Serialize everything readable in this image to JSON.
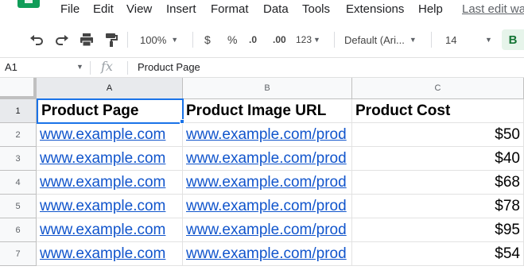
{
  "menu": {
    "items": [
      "File",
      "Edit",
      "View",
      "Insert",
      "Format",
      "Data",
      "Tools",
      "Extensions",
      "Help"
    ],
    "last_edit": "Last edit wa"
  },
  "toolbar": {
    "zoom": "100%",
    "currency": "$",
    "percent": "%",
    "decrease_decimal": ".0",
    "increase_decimal": ".00",
    "number_format": "123",
    "font": "Default (Ari...",
    "font_size": "14",
    "bold": "B"
  },
  "formula_bar": {
    "cell_ref": "A1",
    "fx": "fx",
    "content": "Product Page"
  },
  "sheet": {
    "columns": [
      "A",
      "B",
      "C"
    ],
    "rows": [
      "1",
      "2",
      "3",
      "4",
      "5",
      "6",
      "7"
    ],
    "header": [
      "Product Page",
      "Product Image URL",
      "Product Cost"
    ],
    "data": [
      [
        "www.example.com",
        "www.example.com/prod",
        "$50"
      ],
      [
        "www.example.com",
        "www.example.com/prod",
        "$40"
      ],
      [
        "www.example.com",
        "www.example.com/prod",
        "$68"
      ],
      [
        "www.example.com",
        "www.example.com/prod",
        "$78"
      ],
      [
        "www.example.com",
        "www.example.com/prod",
        "$95"
      ],
      [
        "www.example.com",
        "www.example.com/prod",
        "$54"
      ]
    ]
  },
  "colors": {
    "link": "#1155cc",
    "selection": "#1a73e8",
    "brand": "#0f9d58"
  }
}
